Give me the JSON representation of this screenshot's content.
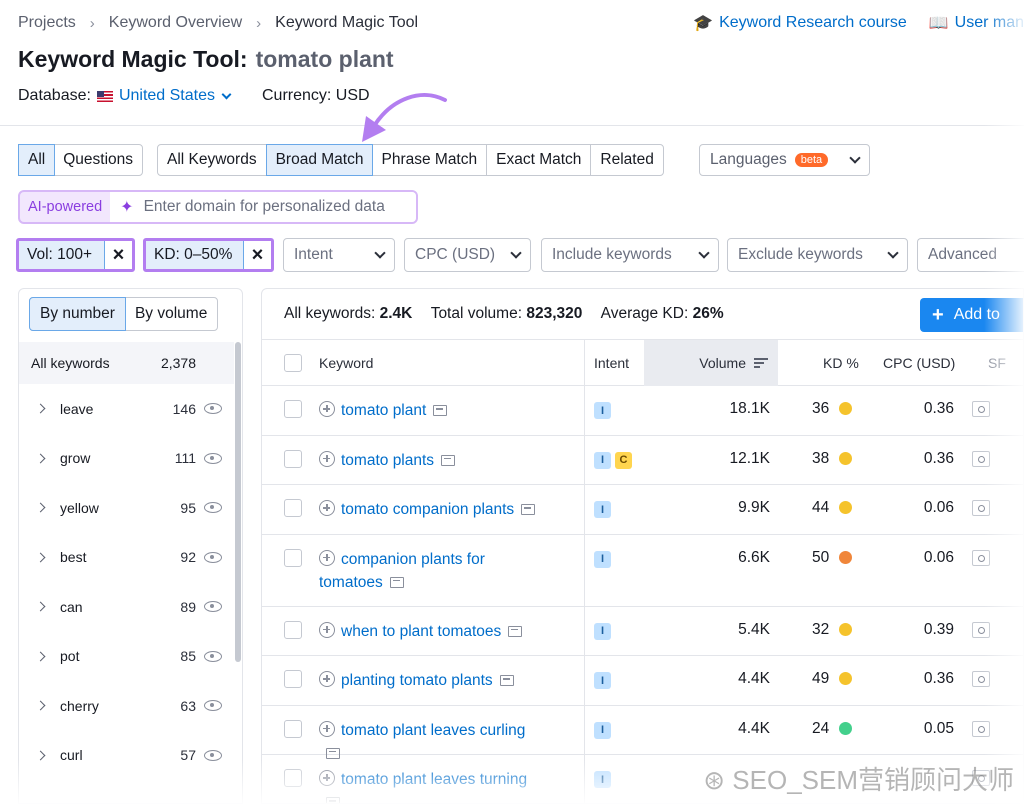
{
  "breadcrumbs": [
    "Projects",
    "Keyword Overview",
    "Keyword Magic Tool"
  ],
  "top_links": {
    "course": "Keyword Research course",
    "manual": "User man"
  },
  "title": {
    "tool": "Keyword Magic Tool:",
    "query": "tomato plant"
  },
  "database": {
    "label": "Database:",
    "value": "United States",
    "currency": "Currency: USD"
  },
  "tabs_left": [
    {
      "label": "All",
      "active": true
    },
    {
      "label": "Questions",
      "active": false
    }
  ],
  "match_tabs": [
    {
      "label": "All Keywords",
      "active": false
    },
    {
      "label": "Broad Match",
      "active": true
    },
    {
      "label": "Phrase Match",
      "active": false
    },
    {
      "label": "Exact Match",
      "active": false
    },
    {
      "label": "Related",
      "active": false
    }
  ],
  "languages": {
    "label": "Languages",
    "badge": "beta"
  },
  "ai": {
    "label": "AI-powered",
    "placeholder": "Enter domain for personalized data"
  },
  "filters": {
    "active": [
      {
        "label": "Vol: 100+"
      },
      {
        "label": "KD: 0–50%"
      }
    ],
    "dropdowns": [
      "Intent",
      "CPC (USD)",
      "Include keywords",
      "Exclude keywords",
      "Advanced"
    ]
  },
  "groups": {
    "toggle": [
      "By number",
      "By volume"
    ],
    "all_label": "All keywords",
    "all_count": "2,378",
    "items": [
      {
        "name": "leave",
        "count": "146"
      },
      {
        "name": "grow",
        "count": "111"
      },
      {
        "name": "yellow",
        "count": "95"
      },
      {
        "name": "best",
        "count": "92"
      },
      {
        "name": "can",
        "count": "89"
      },
      {
        "name": "pot",
        "count": "85"
      },
      {
        "name": "cherry",
        "count": "63"
      },
      {
        "name": "curl",
        "count": "57"
      }
    ]
  },
  "summary": {
    "all_label": "All keywords:",
    "all_value": "2.4K",
    "vol_label": "Total volume:",
    "vol_value": "823,320",
    "kd_label": "Average KD:",
    "kd_value": "26%",
    "add_button": "Add to"
  },
  "columns": {
    "keyword": "Keyword",
    "intent": "Intent",
    "volume": "Volume",
    "kd": "KD %",
    "cpc": "CPC (USD)",
    "sf": "SF"
  },
  "colors": {
    "kd_yellow": "#f5c32c",
    "kd_orange": "#f0863a",
    "kd_green": "#43d08c",
    "accent": "#006dca",
    "highlight": "#b37ef0"
  },
  "rows": [
    {
      "keyword": "tomato plant",
      "intents": [
        "I"
      ],
      "volume": "18.1K",
      "kd": "36",
      "kd_color": "#f5c32c",
      "cpc": "0.36"
    },
    {
      "keyword": "tomato plants",
      "intents": [
        "I",
        "C"
      ],
      "volume": "12.1K",
      "kd": "38",
      "kd_color": "#f5c32c",
      "cpc": "0.36"
    },
    {
      "keyword": "tomato companion plants",
      "intents": [
        "I"
      ],
      "volume": "9.9K",
      "kd": "44",
      "kd_color": "#f5c32c",
      "cpc": "0.06"
    },
    {
      "keyword": "companion plants for tomatoes",
      "intents": [
        "I"
      ],
      "volume": "6.6K",
      "kd": "50",
      "kd_color": "#f0863a",
      "cpc": "0.06"
    },
    {
      "keyword": "when to plant tomatoes",
      "intents": [
        "I"
      ],
      "volume": "5.4K",
      "kd": "32",
      "kd_color": "#f5c32c",
      "cpc": "0.39"
    },
    {
      "keyword": "planting tomato plants",
      "intents": [
        "I"
      ],
      "volume": "4.4K",
      "kd": "49",
      "kd_color": "#f5c32c",
      "cpc": "0.36"
    },
    {
      "keyword": "tomato plant leaves curling",
      "intents": [
        "I"
      ],
      "volume": "4.4K",
      "kd": "24",
      "kd_color": "#43d08c",
      "cpc": "0.05"
    },
    {
      "keyword": "tomato plant leaves turning",
      "intents": [
        "I"
      ],
      "volume": "",
      "kd": "",
      "kd_color": "#f5c32c",
      "cpc": ""
    }
  ],
  "watermark": "SEO_SEM营销顾问大师"
}
